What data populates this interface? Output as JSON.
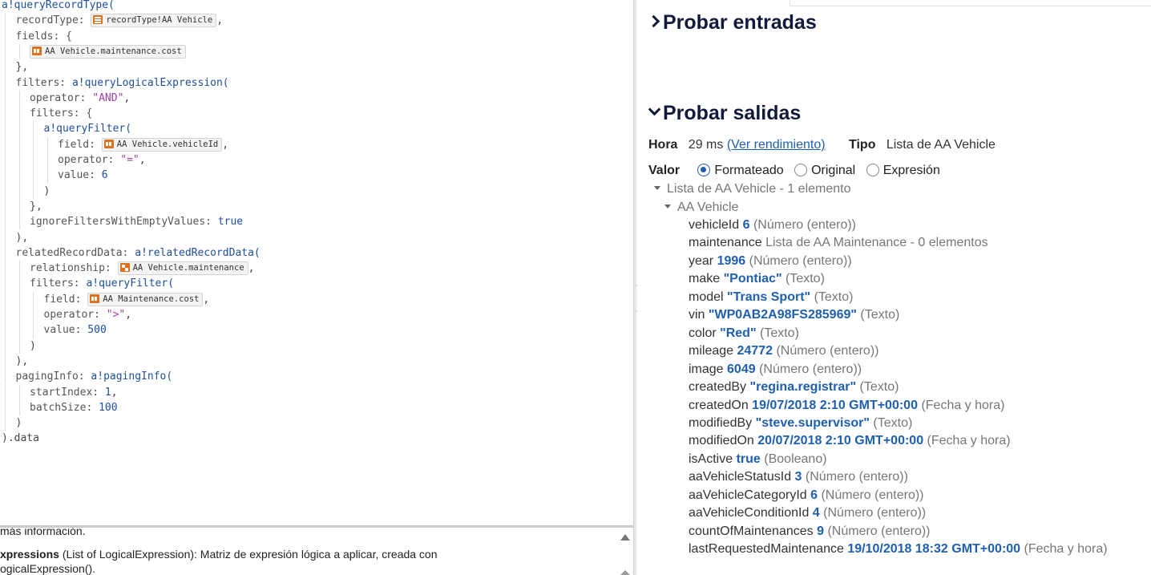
{
  "editor": {
    "lines": [
      {
        "indent": 0,
        "parts": [
          [
            "fn",
            "a!queryRecordType("
          ]
        ]
      },
      {
        "indent": 1,
        "parts": [
          [
            "param",
            "recordType: "
          ],
          [
            "chip-rt",
            "recordType!AA Vehicle"
          ],
          [
            "punc",
            ","
          ]
        ]
      },
      {
        "indent": 1,
        "parts": [
          [
            "param",
            "fields: {"
          ]
        ]
      },
      {
        "indent": 2,
        "parts": [
          [
            "chip-fd",
            "AA Vehicle.maintenance.cost"
          ]
        ]
      },
      {
        "indent": 1,
        "parts": [
          [
            "punc",
            "},"
          ]
        ]
      },
      {
        "indent": 1,
        "parts": [
          [
            "param",
            "filters: "
          ],
          [
            "fn",
            "a!queryLogicalExpression("
          ]
        ]
      },
      {
        "indent": 2,
        "parts": [
          [
            "param",
            "operator: "
          ],
          [
            "str",
            "\"AND\""
          ],
          [
            "punc",
            ","
          ]
        ]
      },
      {
        "indent": 2,
        "parts": [
          [
            "param",
            "filters: {"
          ]
        ]
      },
      {
        "indent": 3,
        "parts": [
          [
            "fn",
            "a!queryFilter("
          ]
        ]
      },
      {
        "indent": 4,
        "parts": [
          [
            "param",
            "field: "
          ],
          [
            "chip-fd",
            "AA Vehicle.vehicleId"
          ],
          [
            "punc",
            ","
          ]
        ]
      },
      {
        "indent": 4,
        "parts": [
          [
            "param",
            "operator: "
          ],
          [
            "str",
            "\"=\""
          ],
          [
            "punc",
            ","
          ]
        ]
      },
      {
        "indent": 4,
        "parts": [
          [
            "param",
            "value: "
          ],
          [
            "num",
            "6"
          ]
        ]
      },
      {
        "indent": 3,
        "parts": [
          [
            "punc",
            ")"
          ]
        ]
      },
      {
        "indent": 2,
        "parts": [
          [
            "punc",
            "},"
          ]
        ]
      },
      {
        "indent": 2,
        "parts": [
          [
            "param",
            "ignoreFiltersWithEmptyValues: "
          ],
          [
            "kw",
            "true"
          ]
        ]
      },
      {
        "indent": 1,
        "parts": [
          [
            "punc",
            "),"
          ]
        ]
      },
      {
        "indent": 1,
        "parts": [
          [
            "param",
            "relatedRecordData: "
          ],
          [
            "fn",
            "a!relatedRecordData("
          ]
        ]
      },
      {
        "indent": 2,
        "parts": [
          [
            "param",
            "relationship: "
          ],
          [
            "chip-rel",
            "AA Vehicle.maintenance"
          ],
          [
            "punc",
            ","
          ]
        ]
      },
      {
        "indent": 2,
        "parts": [
          [
            "param",
            "filters: "
          ],
          [
            "fn",
            "a!queryFilter("
          ]
        ]
      },
      {
        "indent": 3,
        "parts": [
          [
            "param",
            "field: "
          ],
          [
            "chip-fd",
            "AA Maintenance.cost"
          ],
          [
            "punc",
            ","
          ]
        ]
      },
      {
        "indent": 3,
        "parts": [
          [
            "param",
            "operator: "
          ],
          [
            "str",
            "\">\""
          ],
          [
            "punc",
            ","
          ]
        ]
      },
      {
        "indent": 3,
        "parts": [
          [
            "param",
            "value: "
          ],
          [
            "num",
            "500"
          ]
        ]
      },
      {
        "indent": 2,
        "parts": [
          [
            "punc",
            ")"
          ]
        ]
      },
      {
        "indent": 1,
        "parts": [
          [
            "punc",
            "),"
          ]
        ]
      },
      {
        "indent": 1,
        "parts": [
          [
            "param",
            "pagingInfo: "
          ],
          [
            "fn",
            "a!pagingInfo("
          ]
        ]
      },
      {
        "indent": 2,
        "parts": [
          [
            "param",
            "startIndex: "
          ],
          [
            "num",
            "1"
          ],
          [
            "punc",
            ","
          ]
        ]
      },
      {
        "indent": 2,
        "parts": [
          [
            "param",
            "batchSize: "
          ],
          [
            "num",
            "100"
          ]
        ]
      },
      {
        "indent": 1,
        "parts": [
          [
            "punc",
            ")"
          ]
        ]
      },
      {
        "indent": 0,
        "parts": [
          [
            "punc",
            ").data"
          ]
        ]
      }
    ]
  },
  "help": {
    "line1": "más información.",
    "line2_bold": "xpressions",
    "line2_rest": " (List of LogicalExpression): Matriz de expresión lógica a aplicar, creada con",
    "line3": "ogicalExpression()."
  },
  "right": {
    "inputs_title": "Probar entradas",
    "outputs_title": "Probar salidas",
    "time_label": "Hora",
    "time_value": "29 ms",
    "perf_link": "(Ver rendimiento)",
    "type_label": "Tipo",
    "type_value": "Lista de AA Vehicle",
    "value_label": "Valor",
    "options": [
      "Formateado",
      "Original",
      "Expresión"
    ],
    "tree_root": "Lista de AA Vehicle - 1 elemento",
    "tree_child": "AA Vehicle",
    "fields": [
      {
        "name": "vehicleId",
        "value": "6",
        "type": "(Número (entero))"
      },
      {
        "name": "maintenance",
        "value": "",
        "type": "Lista de AA Maintenance - 0 elementos"
      },
      {
        "name": "year",
        "value": "1996",
        "type": "(Número (entero))"
      },
      {
        "name": "make",
        "value": "\"Pontiac\"",
        "type": "(Texto)"
      },
      {
        "name": "model",
        "value": "\"Trans Sport\"",
        "type": "(Texto)"
      },
      {
        "name": "vin",
        "value": "\"WP0AB2A98FS285969\"",
        "type": "(Texto)"
      },
      {
        "name": "color",
        "value": "\"Red\"",
        "type": "(Texto)"
      },
      {
        "name": "mileage",
        "value": "24772",
        "type": "(Número (entero))"
      },
      {
        "name": "image",
        "value": "6049",
        "type": "(Número (entero))"
      },
      {
        "name": "createdBy",
        "value": "\"regina.registrar\"",
        "type": "(Texto)"
      },
      {
        "name": "createdOn",
        "value": "19/07/2018 2:10 GMT+00:00",
        "type": "(Fecha y hora)"
      },
      {
        "name": "modifiedBy",
        "value": "\"steve.supervisor\"",
        "type": "(Texto)"
      },
      {
        "name": "modifiedOn",
        "value": "20/07/2018 2:10 GMT+00:00",
        "type": "(Fecha y hora)"
      },
      {
        "name": "isActive",
        "value": "true",
        "type": "(Booleano)"
      },
      {
        "name": "aaVehicleStatusId",
        "value": "3",
        "type": "(Número (entero))"
      },
      {
        "name": "aaVehicleCategoryId",
        "value": "6",
        "type": "(Número (entero))"
      },
      {
        "name": "aaVehicleConditionId",
        "value": "4",
        "type": "(Número (entero))"
      },
      {
        "name": "countOfMaintenances",
        "value": "9",
        "type": "(Número (entero))"
      },
      {
        "name": "lastRequestedMaintenance",
        "value": "19/10/2018 18:32 GMT+00:00",
        "type": "(Fecha y hora)"
      }
    ],
    "colors": {
      "accent": "#1f5fb0",
      "heading": "#111a3a",
      "chip_icon": "#e0701c"
    }
  }
}
